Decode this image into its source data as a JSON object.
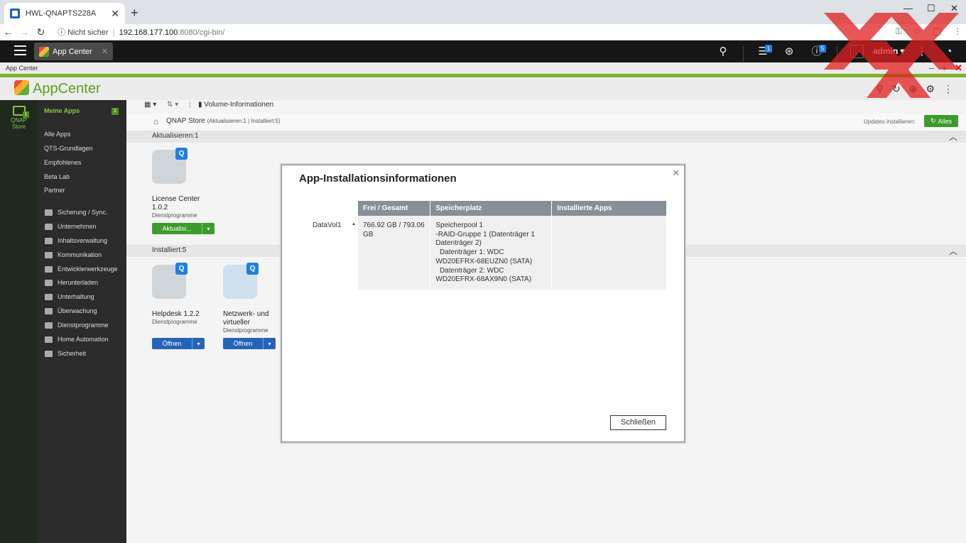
{
  "browser": {
    "tab_title": "HWL-QNAPTS228A",
    "url_info": "Nicht sicher",
    "url_host": "192.168.177.100",
    "url_path": ":8080/cgi-bin/"
  },
  "qts": {
    "app_tab": "App Center",
    "user": "admin",
    "badge_tasks": "1",
    "badge_info": "5"
  },
  "window": {
    "title": "App Center",
    "app_name": "AppCenter"
  },
  "rail": {
    "store_label": "QNAP Store",
    "badge": "1"
  },
  "sidebar": {
    "my_apps": "Meine Apps",
    "my_apps_badge": "1",
    "items": [
      "Alle Apps",
      "QTS-Grundlagen",
      "Empfohlenes",
      "Beta Lab",
      "Partner"
    ],
    "categories": [
      "Sicherung / Sync.",
      "Unternehmen",
      "Inhaltsverwaltung",
      "Kommunikation",
      "Entwicklerwerkzeuge",
      "Herunterladen",
      "Unterhaltung",
      "Überwachung",
      "Dienstprogramme",
      "Home Automation",
      "Sicherheit"
    ]
  },
  "main": {
    "toolbar_volume": "Volume-Informationen",
    "store_title": "QNAP Store",
    "store_sub": "(Aktualisieren:1 | Installiert:5)",
    "updates_label": "Updates installieren:",
    "all_button": "Alles",
    "section_update": "Aktualisieren:1",
    "section_installed": "Installiert:5",
    "apps_update": [
      {
        "name": "License Center 1.0.2",
        "category": "Dienstprogramme",
        "action": "Aktualisi..."
      }
    ],
    "apps_installed": [
      {
        "name": "Helpdesk 1.2.2",
        "category": "Dienstprogramme",
        "action": "Öffnen"
      },
      {
        "name": "Netzwerk- und virtueller",
        "category": "Dienstprogramme",
        "action": "Öffnen"
      }
    ]
  },
  "modal": {
    "title": "App-Installationsinformationen",
    "volume": "DataVol1",
    "headers": [
      "Frei / Gesamt",
      "Speicherplatz",
      "Installierte Apps"
    ],
    "free_total": "766.92 GB / 793.06 GB",
    "storage_lines": [
      "Speicherpool 1",
      "-RAID-Gruppe 1 (Datenträger 1 Datenträger 2)",
      "  Datenträger 1: WDC WD20EFRX-68EUZN0 (SATA)",
      "  Datenträger 2: WDC WD20EFRX-68AX9N0 (SATA)"
    ],
    "installed_apps": "",
    "close_button": "Schließen"
  }
}
